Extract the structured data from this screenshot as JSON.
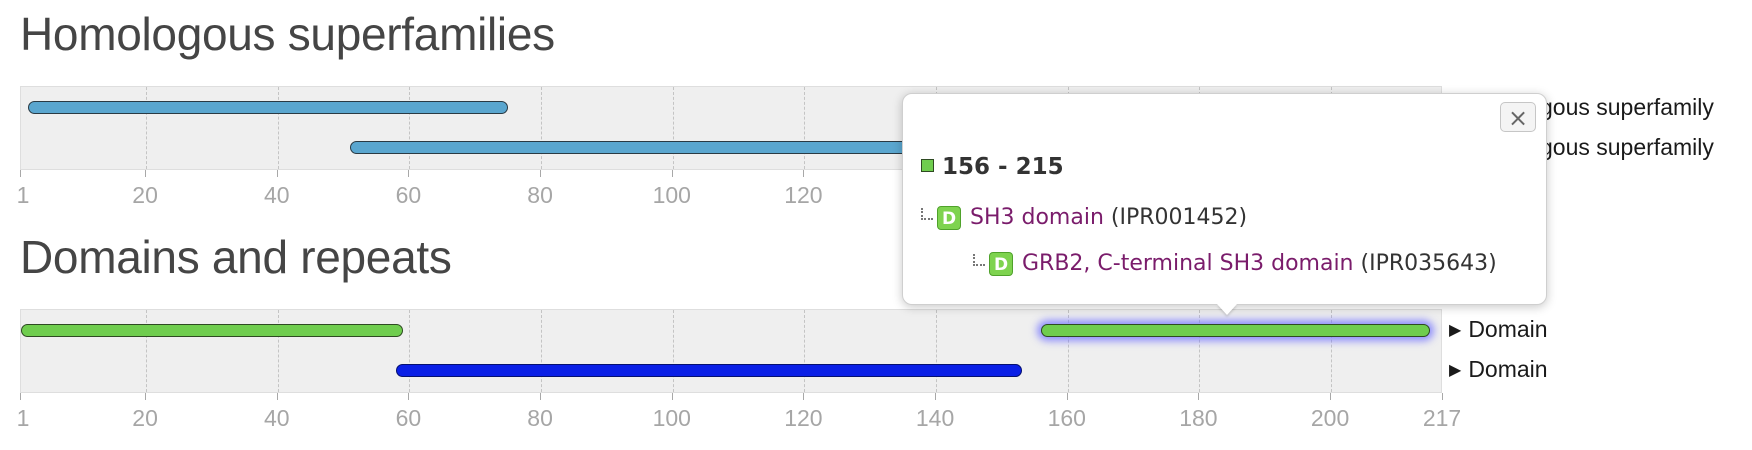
{
  "sections": {
    "superfamilies": {
      "title": "Homologous superfamilies",
      "row_labels": [
        "gous superfamily",
        "gous superfamily"
      ]
    },
    "domains": {
      "title": "Domains and repeats",
      "row_labels": [
        "Domain",
        "Domain"
      ]
    }
  },
  "axis": {
    "min": 1,
    "max": 217,
    "ticks": [
      "1",
      "20",
      "40",
      "60",
      "80",
      "100",
      "120",
      "140",
      "160",
      "180",
      "200",
      "217"
    ]
  },
  "features": {
    "superfamilies": [
      {
        "start": 2,
        "end": 75,
        "color": "#5aa6cf"
      },
      {
        "start": 51,
        "end": 150,
        "color": "#5aa6cf"
      }
    ],
    "domains": [
      {
        "start": 1,
        "end": 59,
        "color": "#6fcd4e"
      },
      {
        "start": 58,
        "end": 153,
        "color": "#0a1fe6"
      },
      {
        "start": 156,
        "end": 215,
        "color": "#6fcd4e",
        "selected": true
      }
    ]
  },
  "popup": {
    "close_label": "×",
    "range": "156 - 215",
    "entries": [
      {
        "badge": "D",
        "name": "SH3 domain",
        "accession": "(IPR001452)"
      },
      {
        "badge": "D",
        "name": "GRB2, C-terminal SH3 domain",
        "accession": "(IPR035643)"
      }
    ]
  },
  "colors": {
    "superfamily_bar": "#5aa6cf",
    "domain_green": "#6fcd4e",
    "domain_blue": "#0a1fe6",
    "link": "#7a1c6b"
  }
}
